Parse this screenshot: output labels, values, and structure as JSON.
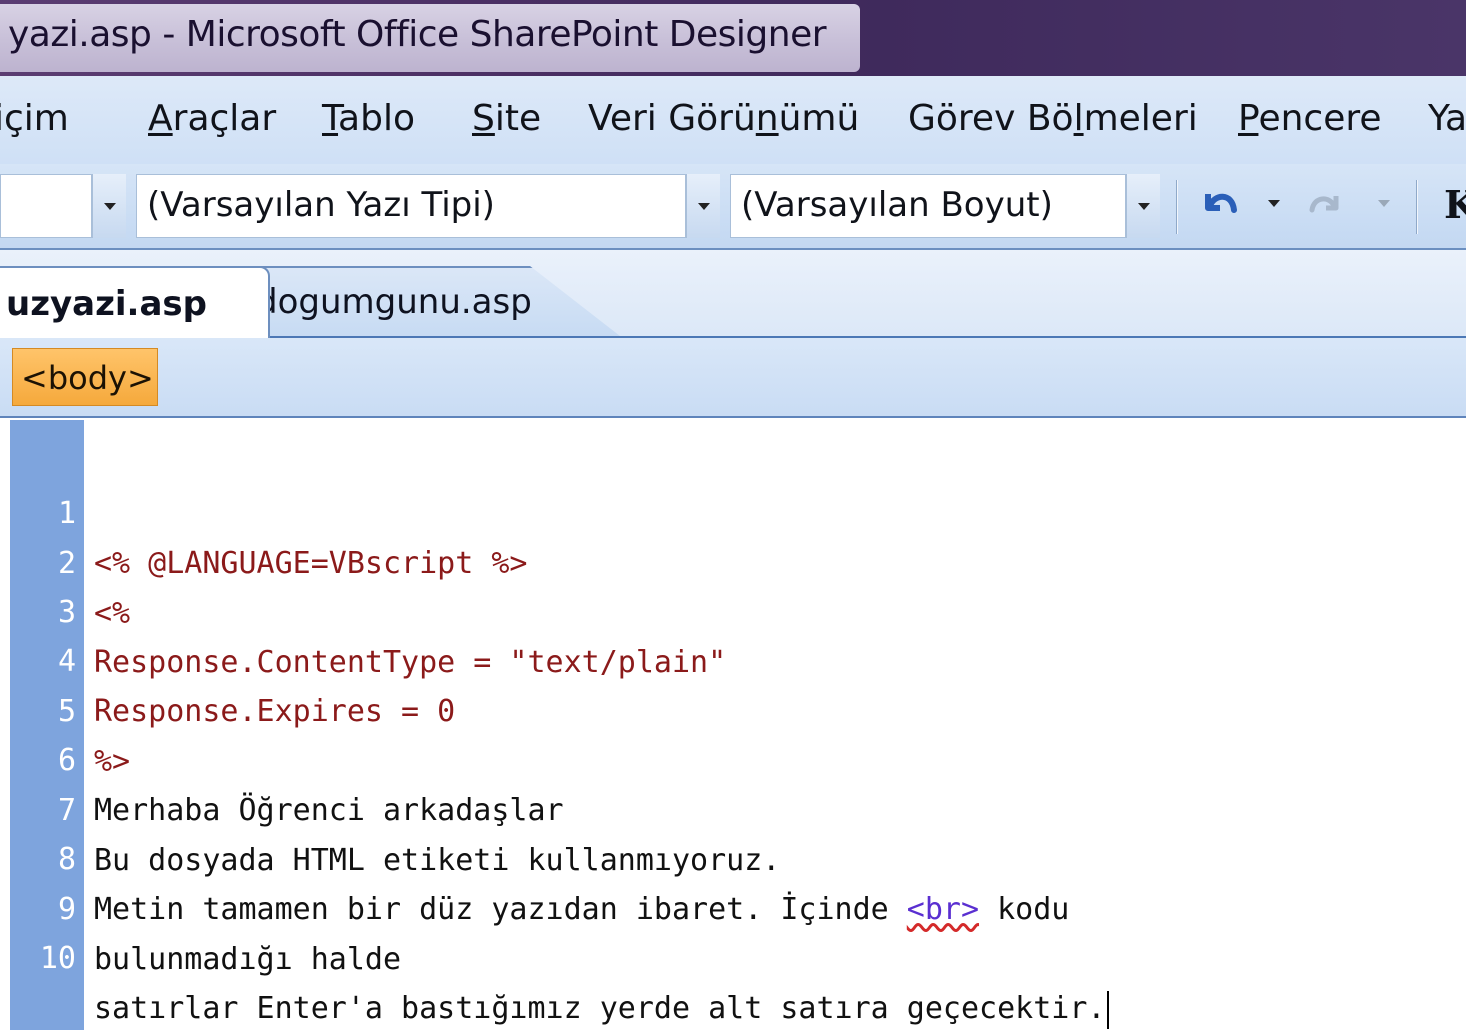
{
  "window": {
    "title": "yazi.asp - Microsoft Office SharePoint Designer"
  },
  "menu": {
    "items": [
      {
        "pre": "Biçim",
        "u": "",
        "post": ""
      },
      {
        "pre": "",
        "u": "A",
        "post": "raçlar"
      },
      {
        "pre": "",
        "u": "T",
        "post": "ablo"
      },
      {
        "pre": "",
        "u": "S",
        "post": "ite"
      },
      {
        "pre": "Veri Görü",
        "u": "n",
        "post": "ümü"
      },
      {
        "pre": "Görev Bö",
        "u": "l",
        "post": "meleri"
      },
      {
        "pre": "",
        "u": "P",
        "post": "encere"
      },
      {
        "pre": "Ya",
        "u": "",
        "post": ""
      }
    ],
    "first_visible": "içim"
  },
  "toolbar": {
    "font_name": "(Varsayılan Yazı Tipi)",
    "font_size": "(Varsayılan Boyut)",
    "undo_icon": "undo-icon",
    "redo_icon": "redo-icon",
    "bold_label": "K"
  },
  "tabs": [
    {
      "label": "uzyazi.asp",
      "active": true
    },
    {
      "label": "dogumgunu.asp",
      "active": false
    }
  ],
  "tag_selector": {
    "tag": "<body>"
  },
  "editor": {
    "lines": [
      {
        "num": "1",
        "kind": "asp",
        "text": "<% @LANGUAGE=VBscript %>"
      },
      {
        "num": "2",
        "kind": "asp",
        "text": "<%"
      },
      {
        "num": "3",
        "kind": "asp",
        "text": "Response.ContentType = \"text/plain\""
      },
      {
        "num": "4",
        "kind": "asp",
        "text": "Response.Expires = 0"
      },
      {
        "num": "5",
        "kind": "asp",
        "text": "%>"
      },
      {
        "num": "6",
        "kind": "plain",
        "text": "Merhaba Öğrenci arkadaşlar"
      },
      {
        "num": "7",
        "kind": "plain",
        "text": "Bu dosyada HTML etiketi kullanmıyoruz."
      },
      {
        "num": "8",
        "kind": "mixed",
        "pre": "Metin tamamen bir düz yazıdan ibaret. İçinde ",
        "tag": "<br>",
        "post": " kodu"
      },
      {
        "num": "9",
        "kind": "plain",
        "text": "bulunmadığı halde"
      },
      {
        "num": "10",
        "kind": "plain",
        "text": "satırlar Enter'a bastığımız yerde alt satıra geçecektir."
      }
    ]
  },
  "colors": {
    "asp_code": "#8b1a1a",
    "plain_text": "#111111",
    "html_tag": "#5a2fd1",
    "gutter": "#7ea4dd",
    "tag_chip": "#f5a93c"
  }
}
